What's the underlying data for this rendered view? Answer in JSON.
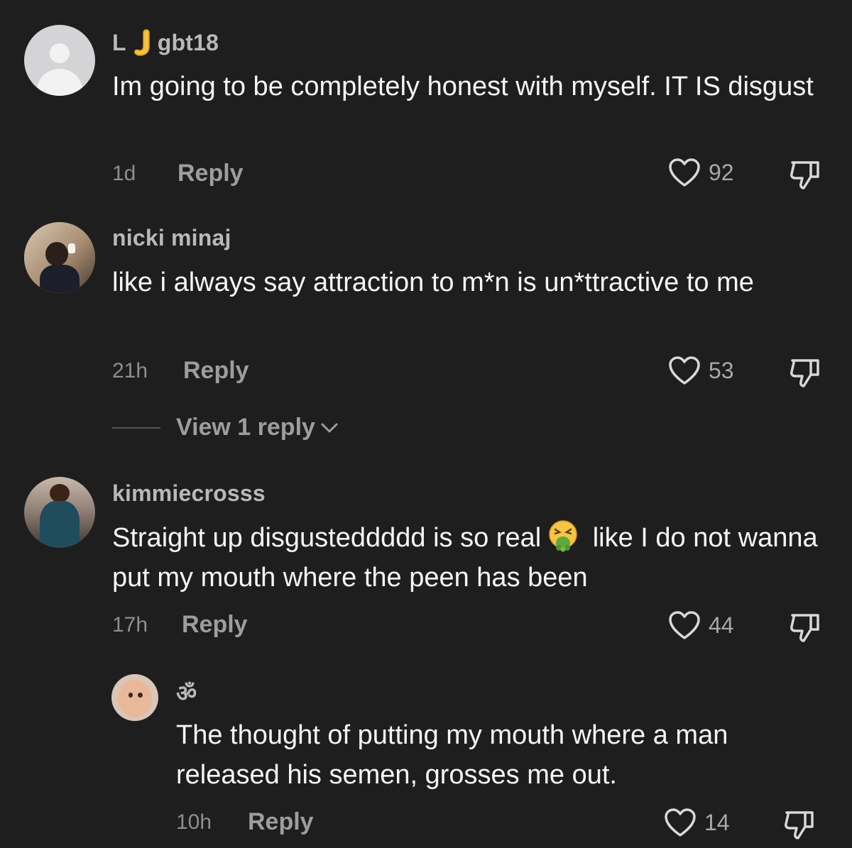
{
  "comments": [
    {
      "username": "L 🫸gbt18",
      "username_prefix": "L",
      "username_suffix": "gbt18",
      "text": "Im going to be completely honest with myself. IT IS disgust",
      "time": "1d",
      "reply_label": "Reply",
      "likes": "92"
    },
    {
      "username": "nicki minaj",
      "text": "like i always say attraction to m*n is un*ttractive to me",
      "time": "21h",
      "reply_label": "Reply",
      "likes": "53",
      "view_replies": "View 1 reply"
    },
    {
      "username": "kimmiecrosss",
      "text_part1": "Straight up disgusteddddd is so real",
      "text_part2": " like I do not wanna put my mouth where the peen has been",
      "time": "17h",
      "reply_label": "Reply",
      "likes": "44"
    },
    {
      "username": "ॐ",
      "text": "The thought of putting my mouth where a man released his semen, grosses me out.",
      "time": "10h",
      "reply_label": "Reply",
      "likes": "14"
    }
  ],
  "icons": {
    "like": "heart-outline-icon",
    "dislike": "thumbs-down-icon",
    "expand": "chevron-down-icon",
    "emoji": "nauseated-face-emoji"
  },
  "colors": {
    "background": "#1e1e1e",
    "username": "#b9b9b9",
    "text": "#f6f6f6",
    "muted": "#9d9d9d"
  }
}
